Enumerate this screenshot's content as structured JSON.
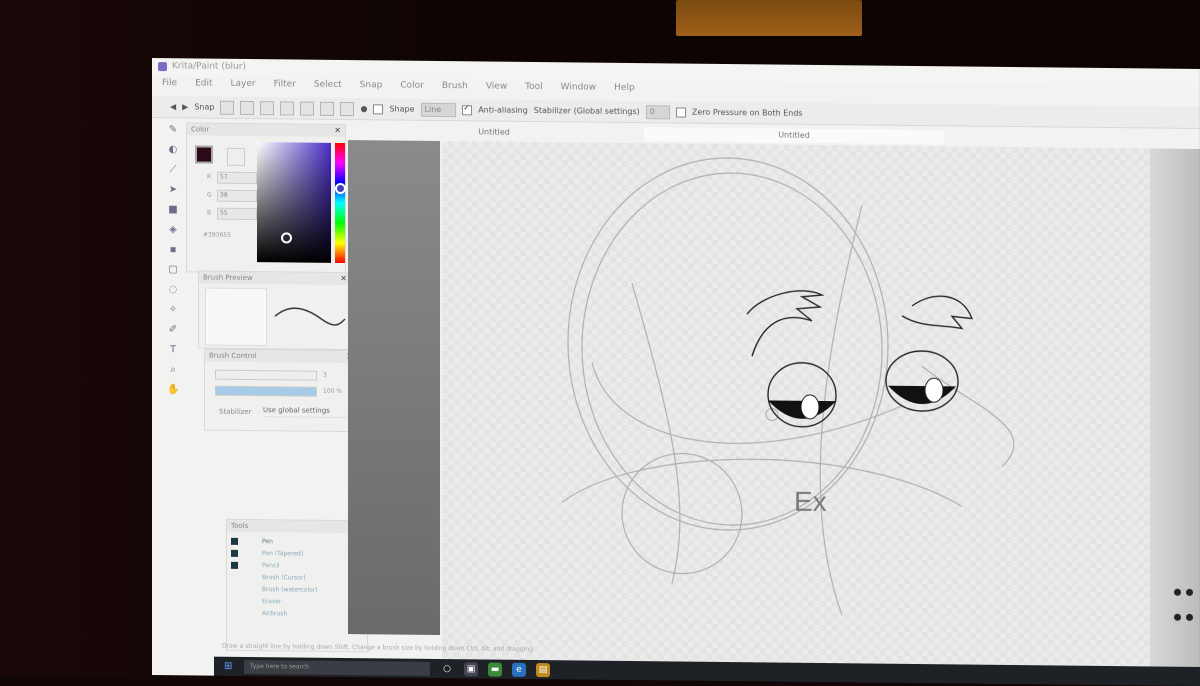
{
  "window": {
    "title": "Krita/Paint (blur)"
  },
  "menu": [
    "File",
    "Edit",
    "Layer",
    "Filter",
    "Select",
    "Snap",
    "Color",
    "Brush",
    "View",
    "Tool",
    "Window",
    "Help"
  ],
  "toolbar": {
    "snap_label": "Snap",
    "shape_label": "Shape",
    "shape_value": "Line",
    "antialias_label": "Anti-aliasing",
    "stabilizer_label": "Stabilizer (Global settings)",
    "stabilizer_value": "0",
    "zero_pressure_label": "Zero Pressure on Both Ends"
  },
  "color_panel": {
    "title": "Color",
    "r_label": "R",
    "r_value": "57",
    "g_label": "G",
    "g_value": "38",
    "b_label": "B",
    "b_value": "55",
    "hex": "#393655",
    "fg_color": "#2a0a18"
  },
  "brush_preview": {
    "title": "Brush Preview"
  },
  "brush_control": {
    "title": "Brush Control",
    "size_value": "3",
    "opacity_value": "100 %",
    "stabilizer_label": "Stabilizer",
    "stabilizer_value": "Use global settings"
  },
  "layers": {
    "title": "Tools",
    "items": [
      "Pen",
      "Pen (Tapered)",
      "Pencil",
      "Brush (Cursor)",
      "Brush (watercolor)",
      "Eraser",
      "Airbrush"
    ]
  },
  "tabs": [
    {
      "label": "Untitled",
      "active": false
    },
    {
      "label": "Untitled",
      "active": true
    }
  ],
  "drawing": {
    "annotation": "Ex"
  },
  "statusbar": "Draw a straight line by holding down Shift. Change a brush size by holding down Ctrl, Alt, and dragging",
  "taskbar": {
    "search_placeholder": "Type here to search"
  }
}
